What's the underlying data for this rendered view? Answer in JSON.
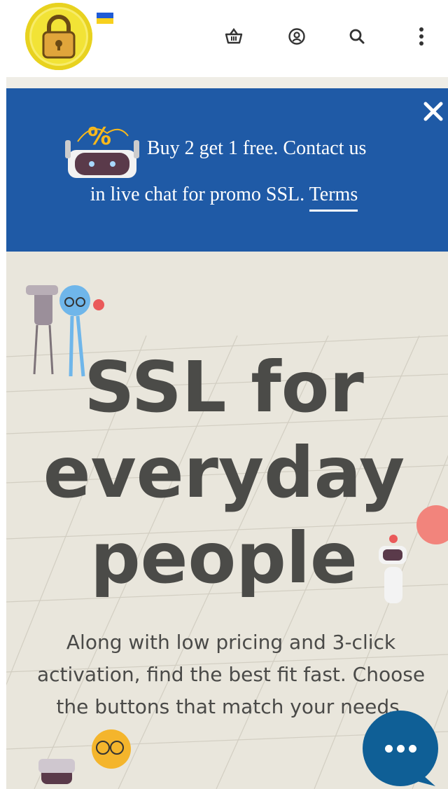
{
  "header": {
    "logo_icon": "padlock-logo-icon",
    "flag_icon": "ukraine-flag-icon",
    "icons": [
      "basket-icon",
      "account-icon",
      "search-icon",
      "more-vertical-icon"
    ]
  },
  "promo": {
    "line1": "Buy 2 get 1 free. Contact us",
    "line2": "in live chat for promo SSL.",
    "terms": "Terms",
    "close_icon": "close-icon",
    "image_icon": "robot-percent-icon",
    "color_bg": "#1f5aa6"
  },
  "hero": {
    "title_line1": "SSL for",
    "title_line2": "everyday",
    "title_line3": "people",
    "description": "Along with low pricing and 3-click activation, find the best fit fast. Choose the buttons that match your needs.",
    "color_bg": "#e9e6dc"
  },
  "chat": {
    "icon": "chat-bubble-icon",
    "color": "#0f5f96"
  }
}
